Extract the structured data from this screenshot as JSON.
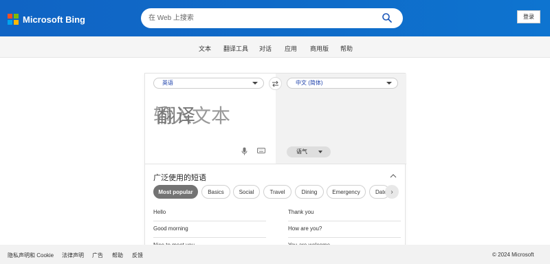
{
  "header": {
    "logo_text": "Microsoft Bing",
    "logo_colors": [
      "#f25022",
      "#7fba00",
      "#00a4ef",
      "#ffb900"
    ],
    "search_placeholder": "在 Web 上搜索",
    "login_label": "登录"
  },
  "nav": {
    "items": [
      "文本",
      "翻译工具",
      "对话",
      "应用",
      "商用版",
      "帮助"
    ]
  },
  "translator": {
    "source_language": "英语",
    "target_language": "中文 (简体)",
    "input_placeholder": "输入文本",
    "output_text": "翻译",
    "tone_label": "语气",
    "swap_icon": "swap-icon",
    "mic_icon": "microphone-icon",
    "keyboard_icon": "keyboard-icon"
  },
  "phrases": {
    "title": "广泛使用的短语",
    "categories": [
      "Most popular",
      "Basics",
      "Social",
      "Travel",
      "Dining",
      "Emergency",
      "Dates"
    ],
    "active_category": "Most popular",
    "left": [
      "Hello",
      "Good morning",
      "Nice to meet you"
    ],
    "right": [
      "Thank you",
      "How are you?",
      "You are welcome"
    ]
  },
  "footer": {
    "links": [
      "隐私声明和 Cookie",
      "法律声明",
      "广告",
      "帮助",
      "反馈"
    ],
    "copyright": "© 2024 Microsoft"
  }
}
